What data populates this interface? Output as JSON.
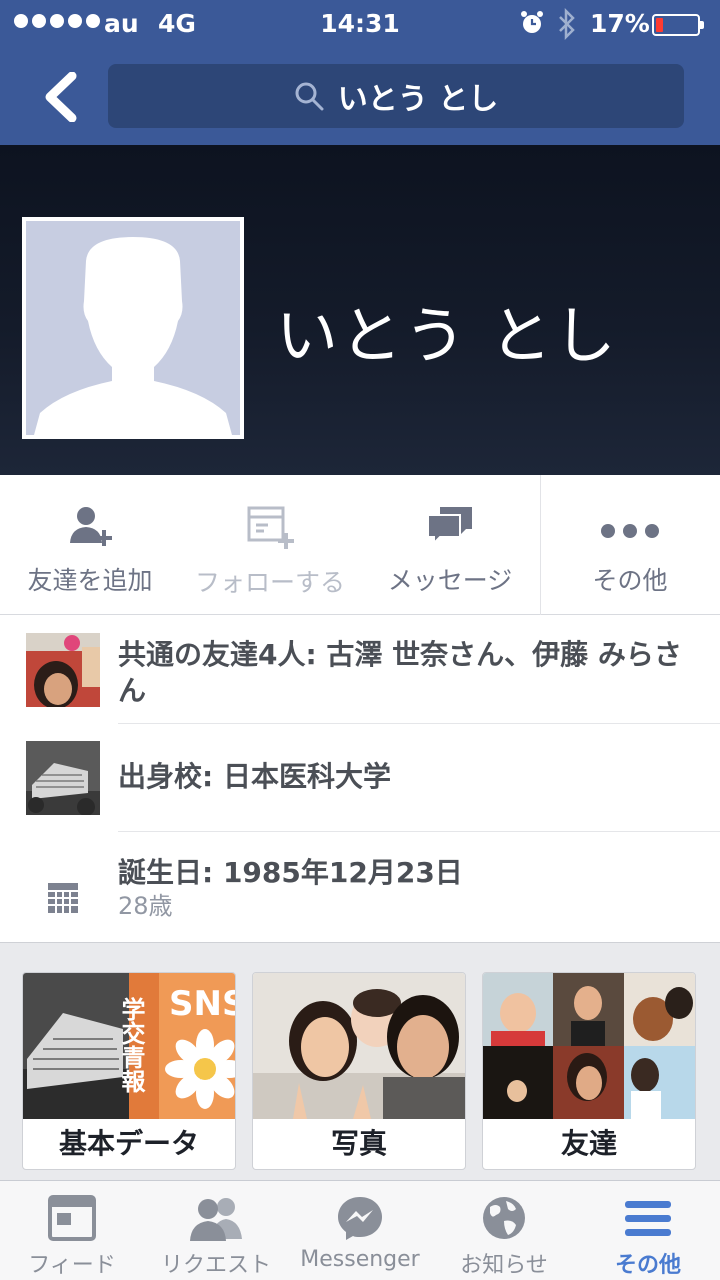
{
  "status_bar": {
    "carrier": "au",
    "network": "4G",
    "time": "14:31",
    "battery_percent": "17%",
    "battery_level": 0.17,
    "battery_color": "#ff3b30"
  },
  "nav": {
    "back_icon": "chevron-left-icon",
    "search_icon": "search-icon",
    "search_text": "いとう とし"
  },
  "profile": {
    "name": "いとう とし",
    "avatar_icon": "default-silhouette-icon"
  },
  "actions": [
    {
      "label": "友達を追加",
      "icon": "add-friend-icon",
      "enabled": true
    },
    {
      "label": "フォローする",
      "icon": "follow-icon",
      "enabled": false
    },
    {
      "label": "メッセージ",
      "icon": "message-icon",
      "enabled": true
    },
    {
      "label": "その他",
      "icon": "more-icon",
      "enabled": true
    }
  ],
  "info": {
    "mutual_friends": "共通の友達4人: 古澤 世奈さん、伊藤 みらさん",
    "school": "出身校: 日本医科大学",
    "birthday": "誕生日: 1985年12月23日",
    "age": "28歳"
  },
  "tiles": [
    {
      "label": "基本データ",
      "art_text": "学交青報",
      "art_text2": "SNS"
    },
    {
      "label": "写真"
    },
    {
      "label": "友達"
    }
  ],
  "tabbar": [
    {
      "label": "フィード",
      "icon": "feed-icon",
      "active": false
    },
    {
      "label": "リクエスト",
      "icon": "friend-requests-icon",
      "active": false
    },
    {
      "label": "Messenger",
      "icon": "messenger-icon",
      "active": false
    },
    {
      "label": "お知らせ",
      "icon": "globe-icon",
      "active": false
    },
    {
      "label": "その他",
      "icon": "menu-icon",
      "active": true
    }
  ],
  "colors": {
    "brand_blue": "#3b5998",
    "search_bg": "#2d4677",
    "active_tab": "#4a7bd0"
  }
}
